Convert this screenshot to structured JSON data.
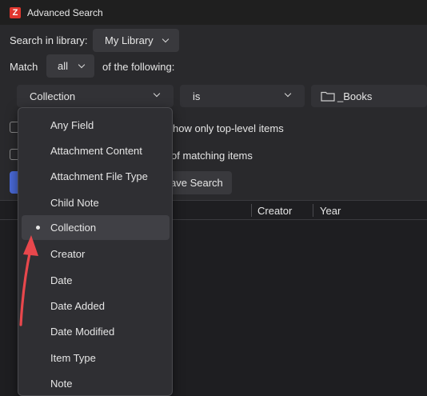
{
  "window": {
    "title": "Advanced Search",
    "app_icon_letter": "Z"
  },
  "search_in": {
    "label": "Search in library:",
    "value": "My Library"
  },
  "match": {
    "label": "Match",
    "value": "all",
    "suffix": "of the following:"
  },
  "condition": {
    "field": "Collection",
    "operator": "is",
    "value": "_Books"
  },
  "options": {
    "top_level_partial": "how only top-level items",
    "matching_partial": "of matching items"
  },
  "save_button_partial": "ave Search",
  "results_columns": {
    "creator": "Creator",
    "year": "Year"
  },
  "dropdown": {
    "selected_index": 4,
    "items": [
      "Any Field",
      "Attachment Content",
      "Attachment File Type",
      "Child Note",
      "Collection",
      "Creator",
      "Date",
      "Date Added",
      "Date Modified",
      "Item Type",
      "Note"
    ]
  },
  "annotation_color": "#e8474c"
}
